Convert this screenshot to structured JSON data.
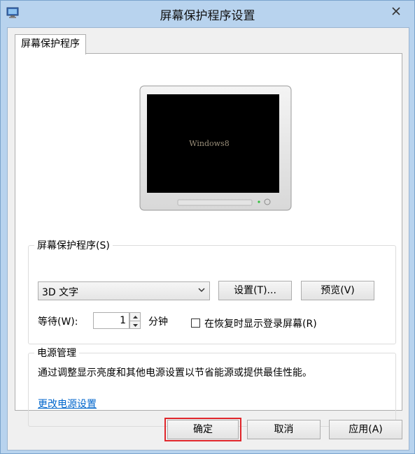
{
  "window": {
    "title": "屏幕保护程序设置",
    "close_icon": "close-icon"
  },
  "tab": {
    "label": "屏幕保护程序"
  },
  "preview": {
    "screen_text": "Windows8"
  },
  "screensaver": {
    "group_label": "屏幕保护程序(S)",
    "selected": "3D 文字",
    "settings_button": "设置(T)...",
    "preview_button": "预览(V)",
    "wait_label": "等待(W):",
    "wait_value": "1",
    "wait_unit": "分钟",
    "resume_checkbox_label": "在恢复时显示登录屏幕(R)",
    "resume_checked": false
  },
  "power": {
    "group_label": "电源管理",
    "description": "通过调整显示亮度和其他电源设置以节省能源或提供最佳性能。",
    "link": "更改电源设置"
  },
  "buttons": {
    "ok": "确定",
    "cancel": "取消",
    "apply": "应用(A)"
  },
  "colors": {
    "title_bar": "#b8d3ee",
    "highlight": "#e0262b",
    "link": "#0066cc"
  }
}
